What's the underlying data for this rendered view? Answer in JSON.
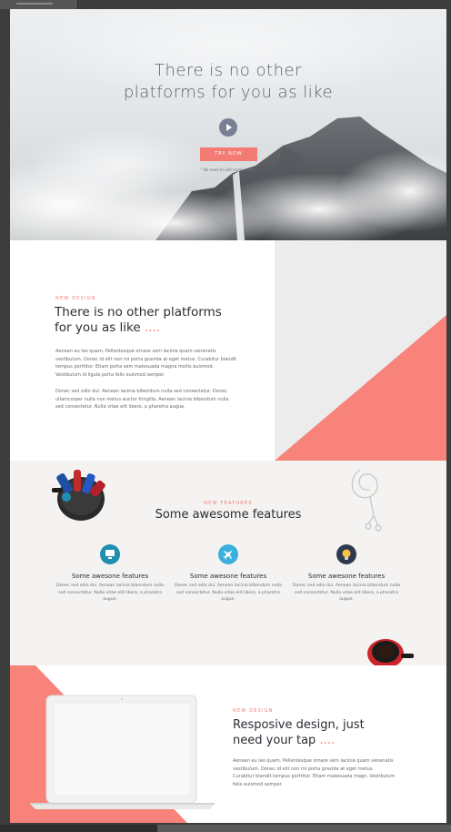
{
  "hero": {
    "title_line1": "There is no other",
    "title_line2": "platforms for you as like",
    "cta_label": "TRY NOW",
    "note": "* No need to add cards details"
  },
  "intro": {
    "eyebrow": "NEW DESIGN",
    "heading_line1": "There is no other platforms",
    "heading_line2": "for you as like",
    "heading_dots": "....",
    "paragraph1": "Aenean eu leo quam. Pellentesque ornare sem lacinia quam venenatis vestibulum. Donec id elit non mi porta gravida at eget metus. Curabitur blandit tempus porttitor. Etiam porta sem malesuada magna mollis euismod. Vestibulum id ligula porta felis euismod semper.",
    "paragraph2": "Donec sed odio dui. Aenean lacinia bibendum nulla sed consectetur. Donec ullamcorper nulla non metus auctor fringilla. Aenean lacinia bibendum nulla sed consectetur. Nulla vitae elit libero, a pharetra augue."
  },
  "features": {
    "eyebrow": "NEW FEATURES",
    "heading": "Some awesome features",
    "items": [
      {
        "icon": "monitor-icon",
        "color": "#1f8fb0",
        "title": "Some awesone features",
        "text": "Donec sed odio dui. Aenean lacinia bibendum nulla sed consectetur. Nulla vitae elit libero, a pharetra augue."
      },
      {
        "icon": "airplane-icon",
        "color": "#3bb0dc",
        "title": "Some awesone features",
        "text": "Donec sed odio dui. Aenean lacinia bibendum nulla sed consectetur. Nulla vitae elit libero, a pharetra augue."
      },
      {
        "icon": "lightbulb-icon",
        "color": "#2d3a4e",
        "title": "Some awesone features",
        "text": "Donec sed odio dui. Aenean lacinia bibendum nulla sed consectetur. Nulla vitae elit libero, a pharetra augue."
      }
    ]
  },
  "responsive": {
    "eyebrow": "NEW DESIGN",
    "heading_line1": "Resposive design, just",
    "heading_line2": "need your tap",
    "heading_dots": "....",
    "paragraph": "Aenean eu leo quam. Pellentesque ornare sem lacinia quam venenatis vestibulum. Donec id elit non mi porta gravida at eget metus. Curabitur blandit tempus porttitor. Etiam malesuada magn. Vestibulum felis euismod semper."
  },
  "colors": {
    "accent": "#f27b73",
    "heading": "#2a2d33",
    "body": "#656a71"
  }
}
